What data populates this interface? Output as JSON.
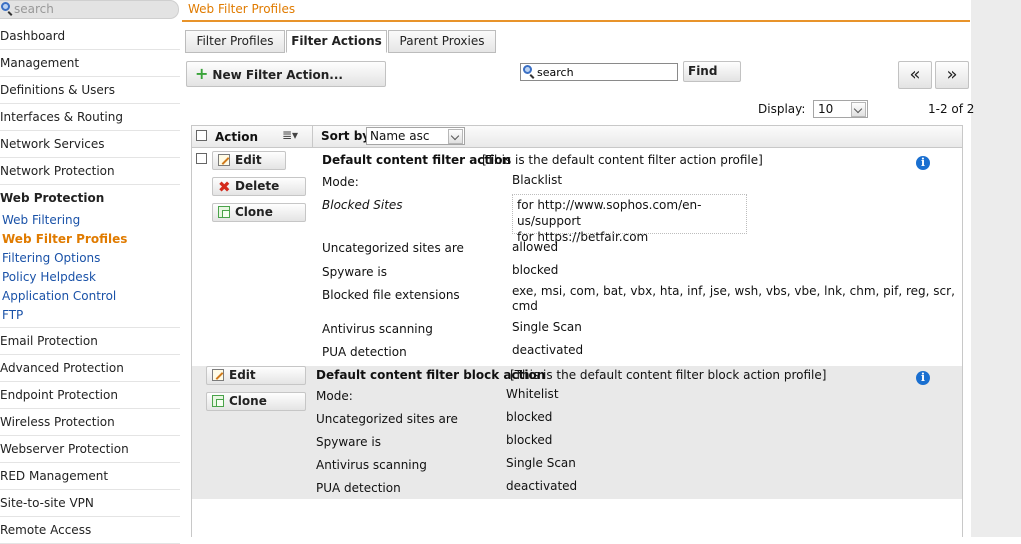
{
  "sidebar": {
    "search_placeholder": "search",
    "items": [
      {
        "label": "Dashboard"
      },
      {
        "label": "Management"
      },
      {
        "label": "Definitions & Users"
      },
      {
        "label": "Interfaces & Routing"
      },
      {
        "label": "Network Services"
      },
      {
        "label": "Network Protection"
      },
      {
        "label": "Web Protection"
      }
    ],
    "sub_items": [
      {
        "label": "Web Filtering"
      },
      {
        "label": "Web Filter Profiles"
      },
      {
        "label": "Filtering Options"
      },
      {
        "label": "Policy Helpdesk"
      },
      {
        "label": "Application Control"
      },
      {
        "label": "FTP"
      }
    ],
    "items_after": [
      {
        "label": "Email Protection"
      },
      {
        "label": "Advanced Protection"
      },
      {
        "label": "Endpoint Protection"
      },
      {
        "label": "Wireless Protection"
      },
      {
        "label": "Webserver Protection"
      },
      {
        "label": "RED Management"
      },
      {
        "label": "Site-to-site VPN"
      },
      {
        "label": "Remote Access"
      }
    ]
  },
  "header": {
    "title": "Web Filter Profiles"
  },
  "tabs": [
    {
      "label": "Filter Profiles"
    },
    {
      "label": "Filter Actions"
    },
    {
      "label": "Parent Proxies"
    }
  ],
  "toolbar": {
    "new_label": "New Filter Action...",
    "search_value": "search",
    "find_label": "Find",
    "first_icon": "«",
    "next_icon": "»",
    "display_label": "Display:",
    "display_value": "10",
    "range": "1-2 of 2"
  },
  "list_header": {
    "action_label": "Action",
    "sort_label": "Sort by:",
    "sort_value": "Name asc"
  },
  "rows": [
    {
      "edit": "Edit",
      "delete": "Delete",
      "clone": "Clone",
      "name": "Default content filter action",
      "desc": "[This is the default content filter action profile]",
      "mode_label": "Mode:",
      "mode": "Blacklist",
      "blocked_label": "Blocked Sites",
      "blocked_sites": [
        "for http://www.sophos.com/en-us/support",
        "for https://betfair.com"
      ],
      "uncat_label": "Uncategorized sites are",
      "uncat": "allowed",
      "spy_label": "Spyware is",
      "spy": "blocked",
      "ext_label": "Blocked file extensions",
      "ext_line1": "exe, msi, com, bat, vbx, hta, inf, jse, wsh, vbs, vbe, lnk, chm, pif, reg, scr,",
      "ext_line2": "cmd",
      "av_label": "Antivirus scanning",
      "av": "Single Scan",
      "pua_label": "PUA detection",
      "pua": "deactivated"
    },
    {
      "edit": "Edit",
      "clone": "Clone",
      "name": "Default content filter block action",
      "desc": "[This is the default content filter block action profile]",
      "mode_label": "Mode:",
      "mode": "Whitelist",
      "uncat_label": "Uncategorized sites are",
      "uncat": "blocked",
      "spy_label": "Spyware is",
      "spy": "blocked",
      "av_label": "Antivirus scanning",
      "av": "Single Scan",
      "pua_label": "PUA detection",
      "pua": "deactivated"
    }
  ]
}
